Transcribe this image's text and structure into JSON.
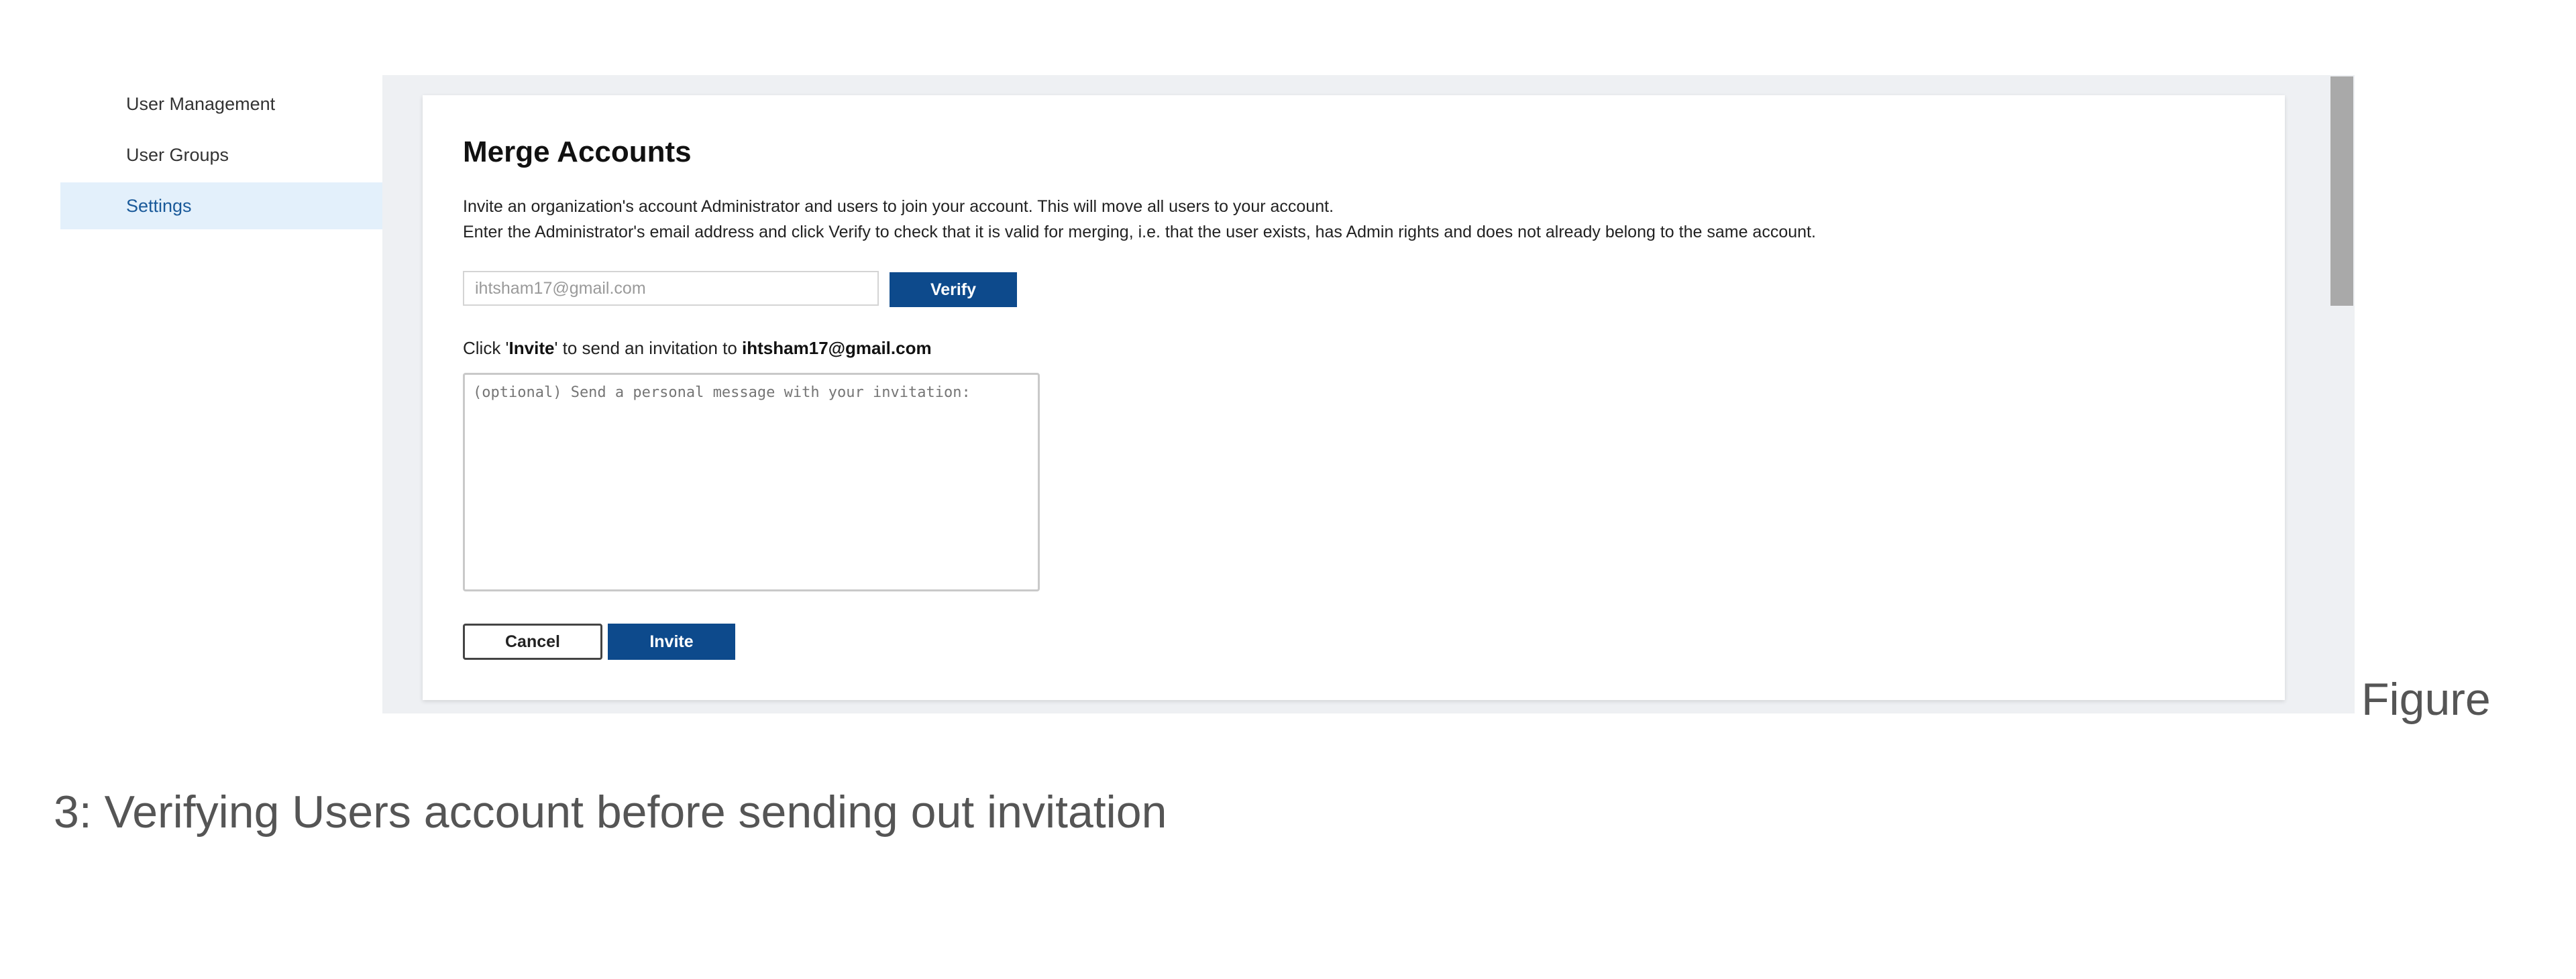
{
  "sidebar": {
    "items": [
      {
        "label": "User Management"
      },
      {
        "label": "User Groups"
      },
      {
        "label": "Settings"
      }
    ]
  },
  "merge": {
    "title": "Merge Accounts",
    "description_line1": "Invite an organization's account Administrator and users to join your account. This will move all users to your account.",
    "description_line2": "Enter the Administrator's email address and click Verify to check that it is valid for merging, i.e. that the user exists, has Admin rights and does not already belong to the same account.",
    "email_value": "ihtsham17@gmail.com",
    "verify_label": "Verify",
    "invite_prefix": "Click '",
    "invite_word": "Invite",
    "invite_middle": "' to send an invitation to ",
    "invite_email": "ihtsham17@gmail.com",
    "message_placeholder": "(optional) Send a personal message with your invitation:",
    "cancel_label": "Cancel",
    "invite_label": "Invite"
  },
  "caption": {
    "part1": "Figure",
    "part2": "3: Verifying Users account before sending out invitation"
  },
  "colors": {
    "accent": "#0d4a8c",
    "sidebar_active_bg": "#e3f0fb"
  }
}
